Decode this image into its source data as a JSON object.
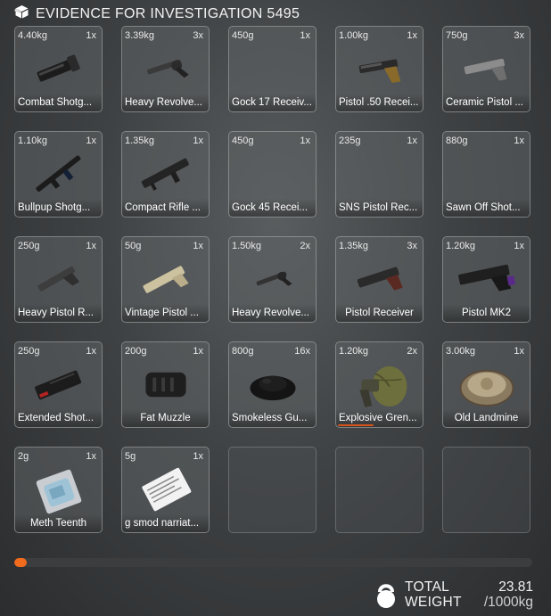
{
  "header": {
    "title": "EVIDENCE FOR INVESTIGATION 5495",
    "icon": "box-icon"
  },
  "slots": [
    {
      "weight": "4.40kg",
      "qty": "1x",
      "label": "Combat Shotg...",
      "icon": "shotgun-receiver-icon",
      "align": "left"
    },
    {
      "weight": "3.39kg",
      "qty": "3x",
      "label": "Heavy Revolve...",
      "icon": "revolver-icon",
      "align": "left"
    },
    {
      "weight": "450g",
      "qty": "1x",
      "label": "Gock 17 Receiv...",
      "icon": "",
      "align": "left"
    },
    {
      "weight": "1.00kg",
      "qty": "1x",
      "label": "Pistol .50 Recei...",
      "icon": "pistol-gold-icon",
      "align": "left"
    },
    {
      "weight": "750g",
      "qty": "3x",
      "label": "Ceramic Pistol ...",
      "icon": "ceramic-pistol-icon",
      "align": "left"
    },
    {
      "weight": "1.10kg",
      "qty": "1x",
      "label": "Bullpup Shotg...",
      "icon": "bullpup-shotgun-icon",
      "align": "left"
    },
    {
      "weight": "1.35kg",
      "qty": "1x",
      "label": "Compact Rifle ...",
      "icon": "compact-rifle-icon",
      "align": "left"
    },
    {
      "weight": "450g",
      "qty": "1x",
      "label": "Gock 45 Recei...",
      "icon": "",
      "align": "left"
    },
    {
      "weight": "235g",
      "qty": "1x",
      "label": "SNS Pistol Rec...",
      "icon": "",
      "align": "left"
    },
    {
      "weight": "880g",
      "qty": "1x",
      "label": "Sawn Off Shot...",
      "icon": "",
      "align": "left"
    },
    {
      "weight": "250g",
      "qty": "1x",
      "label": "Heavy Pistol R...",
      "icon": "heavy-pistol-icon",
      "align": "left"
    },
    {
      "weight": "50g",
      "qty": "1x",
      "label": "Vintage Pistol ...",
      "icon": "vintage-pistol-icon",
      "align": "left"
    },
    {
      "weight": "1.50kg",
      "qty": "2x",
      "label": "Heavy Revolve...",
      "icon": "revolver-small-icon",
      "align": "left"
    },
    {
      "weight": "1.35kg",
      "qty": "3x",
      "label": "Pistol Receiver",
      "icon": "pistol-receiver-icon",
      "align": "center"
    },
    {
      "weight": "1.20kg",
      "qty": "1x",
      "label": "Pistol MK2",
      "icon": "pistol-mk2-icon",
      "align": "center"
    },
    {
      "weight": "250g",
      "qty": "1x",
      "label": "Extended Shot...",
      "icon": "magazine-icon",
      "align": "left"
    },
    {
      "weight": "200g",
      "qty": "1x",
      "label": "Fat Muzzle",
      "icon": "muzzle-icon",
      "align": "center"
    },
    {
      "weight": "800g",
      "qty": "16x",
      "label": "Smokeless Gu...",
      "icon": "gunpowder-icon",
      "align": "left"
    },
    {
      "weight": "1.20kg",
      "qty": "2x",
      "label": "Explosive Gren...",
      "icon": "grenade-icon",
      "align": "left"
    },
    {
      "weight": "3.00kg",
      "qty": "1x",
      "label": "Old Landmine",
      "icon": "landmine-icon",
      "align": "center"
    },
    {
      "weight": "2g",
      "qty": "1x",
      "label": "Meth Teenth",
      "icon": "meth-bag-icon",
      "align": "center"
    },
    {
      "weight": "5g",
      "qty": "1x",
      "label": "g smod narriat...",
      "icon": "paper-note-icon",
      "align": "left"
    },
    {
      "weight": "",
      "qty": "",
      "label": "",
      "icon": "",
      "align": "left"
    },
    {
      "weight": "",
      "qty": "",
      "label": "",
      "icon": "",
      "align": "left"
    },
    {
      "weight": "",
      "qty": "",
      "label": "",
      "icon": "",
      "align": "left"
    }
  ],
  "weight_bar": {
    "percent": 2.4,
    "color": "#f26b1d"
  },
  "footer": {
    "label_line1": "TOTAL",
    "label_line2": "WEIGHT",
    "value": "23.81",
    "max": "/1000kg",
    "icon": "kettlebell-icon"
  }
}
